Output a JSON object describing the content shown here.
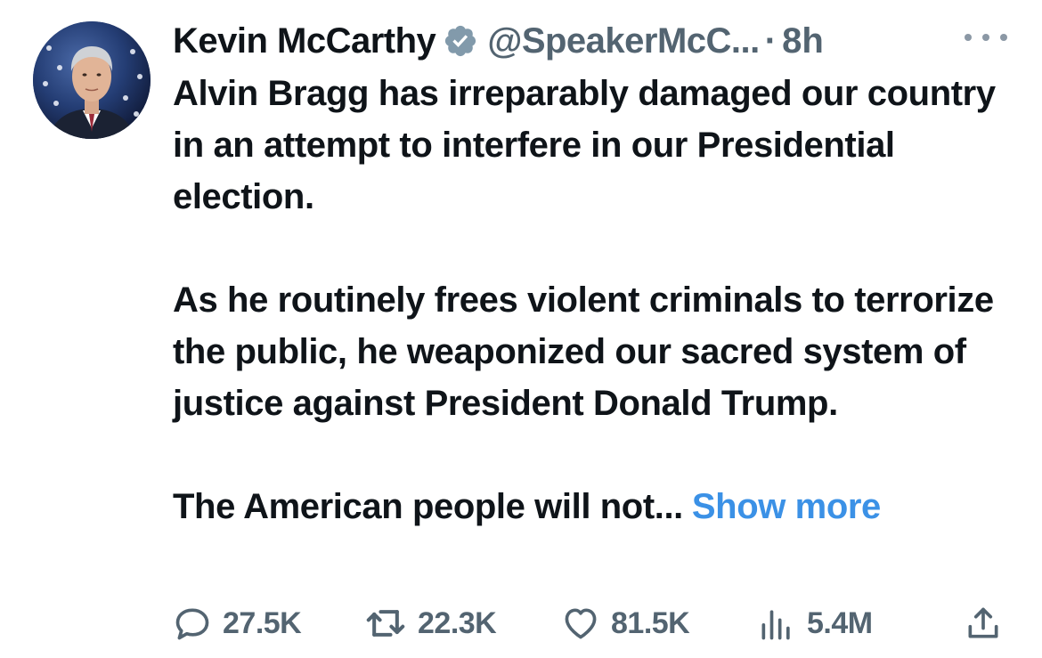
{
  "author": {
    "name": "Kevin McCarthy",
    "handle": "@SpeakerMcC...",
    "separator": "·",
    "time": "8h"
  },
  "tweet": {
    "paragraphs": [
      "Alvin Bragg has irreparably damaged our country in an attempt to interfere in our Presidential election.",
      "As he routinely frees violent criminals to terrorize the public, he weaponized our sacred system of justice against President Donald Trump.",
      "The American people will not..."
    ],
    "show_more": "Show more"
  },
  "metrics": {
    "replies": "27.5K",
    "retweets": "22.3K",
    "likes": "81.5K",
    "views": "5.4M"
  },
  "icons": {
    "verified": "verified-badge-icon",
    "more": "more-dots-icon",
    "reply": "reply-icon",
    "retweet": "retweet-icon",
    "like": "heart-icon",
    "views": "views-icon",
    "share": "share-icon"
  },
  "colors": {
    "text": "#0f1419",
    "secondary": "#536471",
    "link": "#3b91e6",
    "verified_badge": "#829aab"
  }
}
